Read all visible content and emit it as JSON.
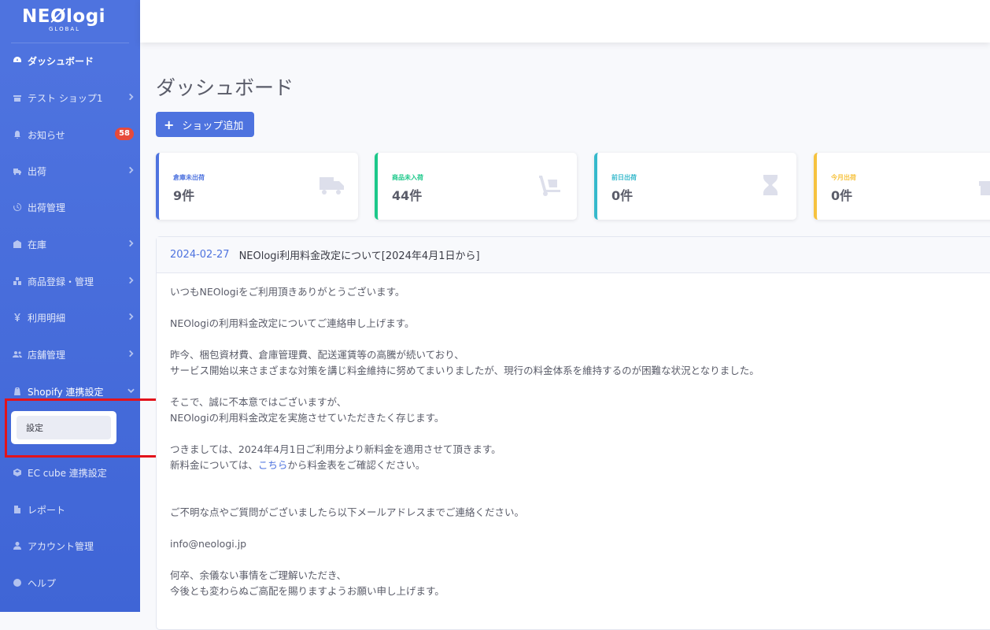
{
  "brand": {
    "name": "NEØlogi",
    "sub": "GLOBAL"
  },
  "sidebar": {
    "items": [
      {
        "label": "ダッシュボード",
        "icon": "dashboard-icon"
      },
      {
        "label": "テスト ショップ1",
        "icon": "store-icon"
      },
      {
        "label": "お知らせ",
        "icon": "bell-icon",
        "badge": "58"
      },
      {
        "label": "出荷",
        "icon": "truck-icon"
      },
      {
        "label": "出荷管理",
        "icon": "history-icon"
      },
      {
        "label": "在庫",
        "icon": "warehouse-icon"
      },
      {
        "label": "商品登録・管理",
        "icon": "boxes-icon"
      },
      {
        "label": "利用明細",
        "icon": "yen-icon"
      },
      {
        "label": "店舗管理",
        "icon": "users-icon"
      },
      {
        "label": "Shopify 連携設定",
        "icon": "shopify-icon"
      },
      {
        "label": "EC cube 連携設定",
        "icon": "cube-icon"
      },
      {
        "label": "レポート",
        "icon": "file-icon"
      },
      {
        "label": "アカウント管理",
        "icon": "user-icon"
      },
      {
        "label": "ヘルプ",
        "icon": "question-icon"
      }
    ],
    "submenu": {
      "label": "設定"
    }
  },
  "main": {
    "title": "ダッシュボード",
    "add_shop_label": "ショップ追加",
    "cards": [
      {
        "label": "倉庫未出荷",
        "value": "9件",
        "color": "#4e73df",
        "icon": "truck-icon"
      },
      {
        "label": "商品未入荷",
        "value": "44件",
        "color": "#1cc88a",
        "icon": "dolly-icon"
      },
      {
        "label": "前日出荷",
        "value": "0件",
        "color": "#36b9cc",
        "icon": "hourglass-icon"
      },
      {
        "label": "今月出荷",
        "value": "0件",
        "color": "#f6c23e",
        "icon": "gift-icon"
      }
    ],
    "notice": {
      "date": "2024-02-27",
      "title": "NEOlogi利用料金改定について[2024年4月1日から]",
      "lines": [
        "いつもNEOlogiをご利用頂きありがとうございます。",
        "",
        "NEOlogiの利用料金改定についてご連絡申し上げます。",
        "",
        "昨今、梱包資材費、倉庫管理費、配送運賃等の高騰が続いており、",
        "サービス開始以来さまざまな対策を講じ料金維持に努めてまいりましたが、現行の料金体系を維持するのが困難な状況となりました。",
        "",
        "そこで、誠に不本意ではございますが、",
        "NEOlogiの利用料金改定を実施させていただきたく存じます。",
        "",
        "つきましては、2024年4月1日ご利用分より新料金を適用させて頂きます。"
      ],
      "link_line": {
        "before": "新料金については、",
        "link": "こちら",
        "after": "から料金表をご確認ください。"
      },
      "lines2": [
        "",
        "",
        "ご不明な点やご質問がございましたら以下メールアドレスまでご連絡ください。",
        "",
        "info@neologi.jp",
        "",
        "何卒、余儀ない事情をご理解いただき、",
        "今後とも変わらぬご高配を賜りますようお願い申し上げます。"
      ]
    }
  }
}
